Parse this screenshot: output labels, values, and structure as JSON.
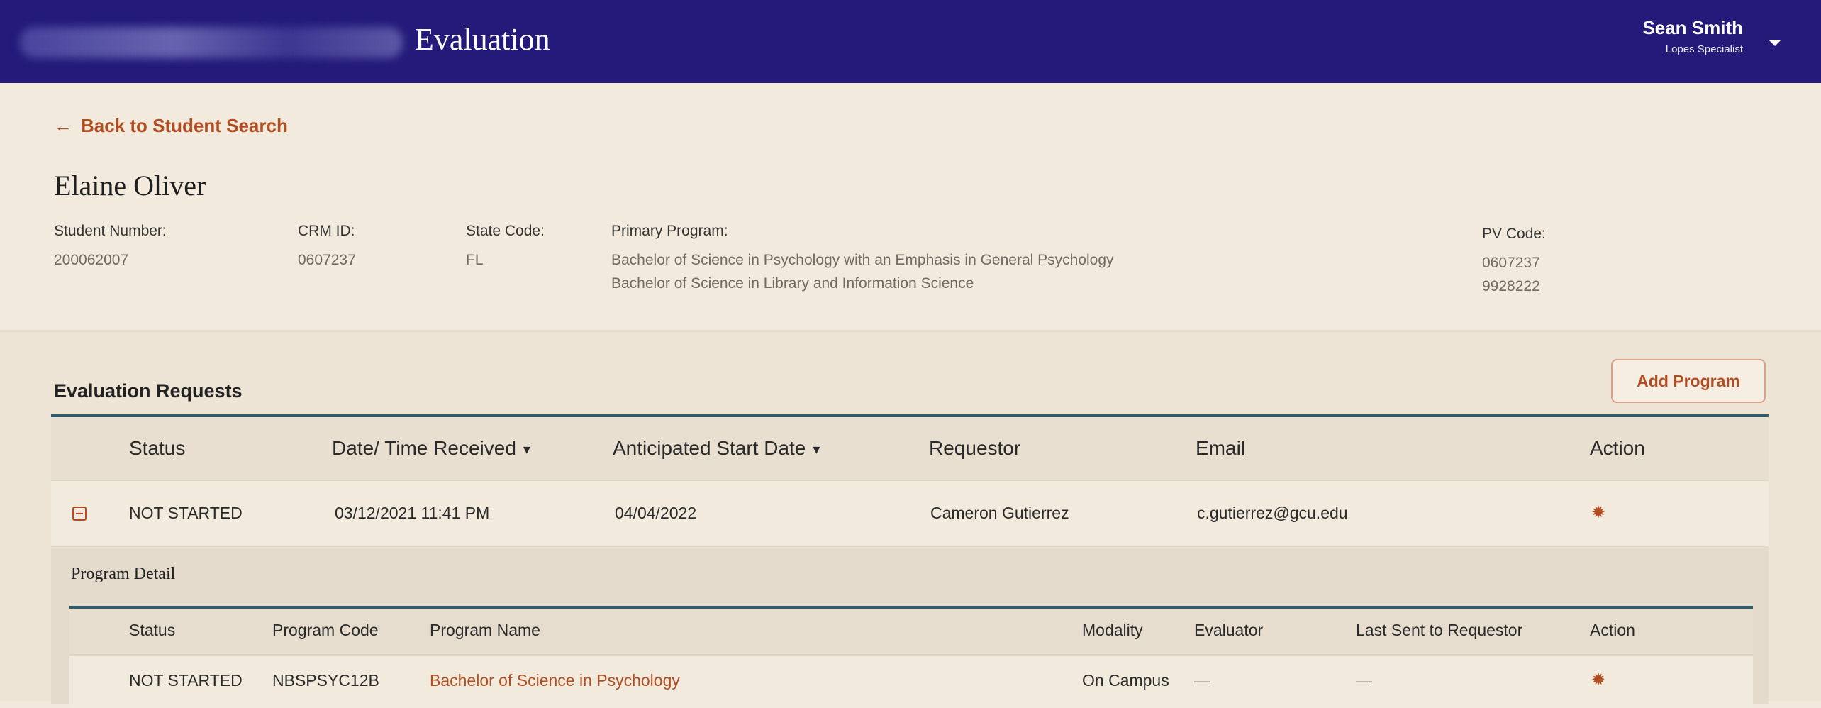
{
  "header": {
    "app_title": "Evaluation",
    "user_name": "Sean Smith",
    "user_role": "Lopes Specialist"
  },
  "nav": {
    "back_label": "Back to Student Search"
  },
  "student": {
    "name": "Elaine Oliver",
    "student_number_label": "Student Number:",
    "student_number": "200062007",
    "crm_id_label": "CRM ID:",
    "crm_id": "0607237",
    "state_code_label": "State Code:",
    "state_code": "FL",
    "primary_program_label": "Primary Program:",
    "primary_programs": [
      "Bachelor of  Science in Psychology with an Emphasis in General Psychology",
      "Bachelor of  Science in Library and Information Science"
    ],
    "pv_code_label": "PV Code:",
    "pv_codes": [
      "0607237",
      "9928222"
    ]
  },
  "requests": {
    "section_title": "Evaluation Requests",
    "add_button_label": "Add Program",
    "columns": {
      "status": "Status",
      "date_received": "Date/ Time Received",
      "start_date": "Anticipated Start Date",
      "requestor": "Requestor",
      "email": "Email",
      "action": "Action"
    },
    "rows": [
      {
        "status": "NOT STARTED",
        "date_received": "03/12/2021 11:41 PM",
        "start_date": "04/04/2022",
        "requestor": "Cameron Gutierrez",
        "email": "c.gutierrez@gcu.edu"
      }
    ]
  },
  "program_detail": {
    "title": "Program Detail",
    "columns": {
      "status": "Status",
      "program_code": "Program Code",
      "program_name": "Program Name",
      "modality": "Modality",
      "evaluator": "Evaluator",
      "last_sent": "Last Sent to Requestor",
      "action": "Action"
    },
    "rows": [
      {
        "status": "NOT STARTED",
        "program_code": "NBSPSYC12B",
        "program_name": "Bachelor of Science in Psychology",
        "modality": "On Campus",
        "evaluator": "—",
        "last_sent": "—"
      }
    ]
  },
  "icons": {
    "back": "arrow-left-icon",
    "user_menu": "chevron-down-icon",
    "expand": "collapse-minus-icon",
    "action": "gear-icon"
  },
  "colors": {
    "topbar": "#231a79",
    "accent": "#b24d22",
    "table_rule": "#2f5c6f",
    "background": "#f2eadc"
  }
}
